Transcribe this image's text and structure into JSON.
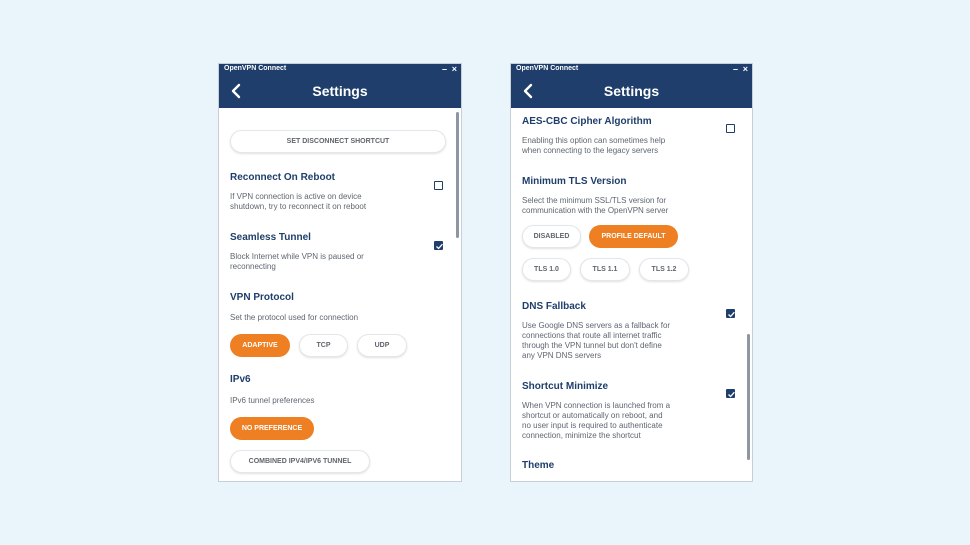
{
  "left": {
    "app_title": "OpenVPN Connect",
    "header_title": "Settings",
    "disconnect_shortcut_label": "SET DISCONNECT SHORTCUT",
    "reconnect": {
      "title": "Reconnect On Reboot",
      "desc_line1": "If VPN connection is active on device",
      "desc_line2": "shutdown, try to reconnect it on reboot",
      "checked": false
    },
    "seamless": {
      "title": "Seamless Tunnel",
      "desc_line1": "Block Internet while VPN is paused or",
      "desc_line2": "reconnecting",
      "checked": true
    },
    "protocol": {
      "title": "VPN Protocol",
      "desc": "Set the protocol used for connection",
      "options": [
        "ADAPTIVE",
        "TCP",
        "UDP"
      ],
      "selected": "ADAPTIVE"
    },
    "ipv6": {
      "title": "IPv6",
      "desc": "IPv6 tunnel preferences",
      "options": [
        "NO PREFERENCE",
        "COMBINED IPV4/IPV6 TUNNEL"
      ],
      "selected": "NO PREFERENCE"
    }
  },
  "right": {
    "app_title": "OpenVPN Connect",
    "header_title": "Settings",
    "aes": {
      "title": "AES-CBC Cipher Algorithm",
      "desc_line1": "Enabling this option can sometimes help",
      "desc_line2": "when connecting to the legacy servers",
      "checked": false
    },
    "tls": {
      "title": "Minimum TLS Version",
      "desc_line1": "Select the minimum SSL/TLS version for",
      "desc_line2": "communication with the OpenVPN server",
      "options_row1": [
        "DISABLED",
        "PROFILE DEFAULT"
      ],
      "options_row2": [
        "TLS 1.0",
        "TLS 1.1",
        "TLS 1.2"
      ],
      "selected": "PROFILE DEFAULT"
    },
    "dns": {
      "title": "DNS Fallback",
      "desc_line1": "Use Google DNS servers as a fallback for",
      "desc_line2": "connections that route all internet traffic",
      "desc_line3": "through the VPN tunnel but don't define",
      "desc_line4": "any VPN DNS servers",
      "checked": true
    },
    "shortcut_min": {
      "title": "Shortcut Minimize",
      "desc_line1": "When VPN connection is launched from a",
      "desc_line2": "shortcut or automatically on reboot, and",
      "desc_line3": "no user input is required to authenticate",
      "desc_line4": "connection, minimize the shortcut",
      "checked": true
    },
    "theme": {
      "title": "Theme"
    }
  },
  "colors": {
    "navy": "#1f3e6b",
    "accent": "#ee7f22",
    "background": "#eaf4fb"
  },
  "icons": {
    "back": "chevron-left-icon",
    "minimize": "minimize-icon",
    "close": "close-icon",
    "check": "checkmark-icon"
  },
  "window_controls": {
    "minimize": "–",
    "close": "×"
  }
}
